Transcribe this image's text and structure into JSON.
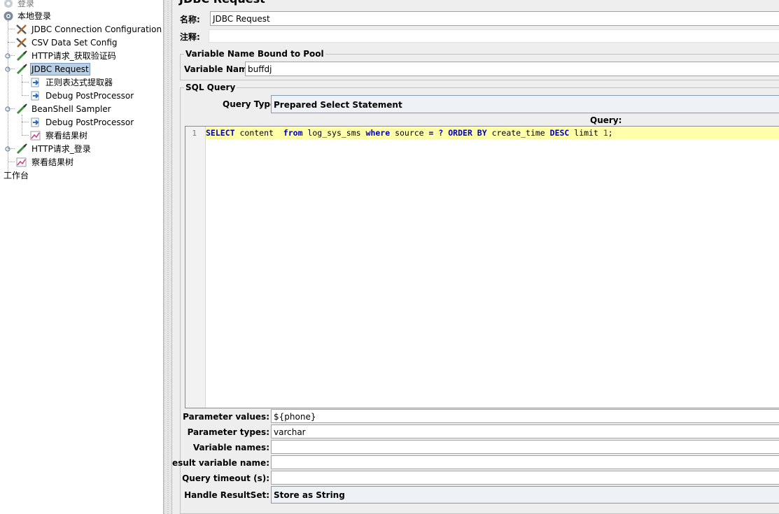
{
  "tree": {
    "items": [
      {
        "label": "登录",
        "icon": "gear-icon"
      },
      {
        "label": "本地登录",
        "icon": "gear-icon"
      },
      {
        "label": "JDBC Connection Configuration",
        "icon": "wrench-icon"
      },
      {
        "label": "CSV Data Set Config",
        "icon": "wrench-icon"
      },
      {
        "label": "HTTP请求_获取验证码",
        "icon": "pipette-icon"
      },
      {
        "label": "JDBC Request",
        "icon": "pipette-icon",
        "selected": true
      },
      {
        "label": "正则表达式提取器",
        "icon": "postprocessor-icon"
      },
      {
        "label": "Debug PostProcessor",
        "icon": "postprocessor-icon"
      },
      {
        "label": "BeanShell Sampler",
        "icon": "pipette-icon"
      },
      {
        "label": "Debug PostProcessor",
        "icon": "postprocessor-icon"
      },
      {
        "label": "察看结果树",
        "icon": "listener-icon"
      },
      {
        "label": "HTTP请求_登录",
        "icon": "pipette-icon"
      },
      {
        "label": "察看结果树",
        "icon": "listener-icon"
      },
      {
        "label": "工作台",
        "icon": ""
      }
    ]
  },
  "panel": {
    "title": "JDBC Request",
    "name_label": "名称:",
    "name_value": "JDBC Request",
    "comment_label": "注释:",
    "comment_value": "",
    "pool_group_title": "Variable Name Bound to Pool",
    "variable_name_label": "Variable Name:",
    "variable_name_value": "buffdj",
    "sql_group_title": "SQL Query",
    "query_type_label": "Query Type:",
    "query_type_value": "Prepared Select Statement",
    "query_label": "Query:",
    "line_number": "1",
    "sql_tokens": [
      {
        "t": "SELECT",
        "c": "kw"
      },
      {
        "t": " content  ",
        "c": "id"
      },
      {
        "t": "from",
        "c": "kw"
      },
      {
        "t": " log_sys_sms ",
        "c": "id"
      },
      {
        "t": "where",
        "c": "kw"
      },
      {
        "t": " source ",
        "c": "id"
      },
      {
        "t": "= ?",
        "c": "kw"
      },
      {
        "t": " ",
        "c": "id"
      },
      {
        "t": "ORDER BY",
        "c": "kw"
      },
      {
        "t": " create_time ",
        "c": "id"
      },
      {
        "t": "DESC",
        "c": "kw"
      },
      {
        "t": " limit ",
        "c": "id"
      },
      {
        "t": "1",
        "c": "num"
      },
      {
        "t": ";",
        "c": "id"
      }
    ],
    "params": [
      {
        "label": "Parameter values:",
        "value": "${phone}",
        "type": "text"
      },
      {
        "label": "Parameter types:",
        "value": "varchar",
        "type": "text"
      },
      {
        "label": "Variable names:",
        "value": "",
        "type": "text"
      },
      {
        "label": "Result variable name:",
        "value": "",
        "type": "text"
      },
      {
        "label": "Query timeout (s):",
        "value": "",
        "type": "text"
      },
      {
        "label": "Handle ResultSet:",
        "value": "Store as String",
        "type": "combo"
      }
    ]
  },
  "colors": {
    "selection": "#b8cfe5",
    "current_line": "#ffffaa",
    "keyword": "#0000c0"
  }
}
